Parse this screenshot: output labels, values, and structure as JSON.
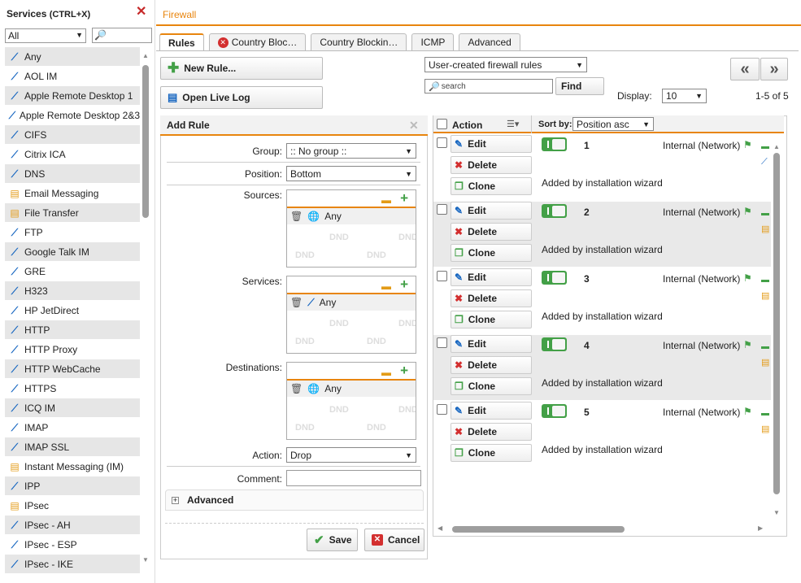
{
  "left_panel": {
    "title": "Services",
    "shortcut": "(CTRL+X)",
    "filter_value": "All",
    "services": [
      {
        "label": "Any",
        "icon": "cable-icon"
      },
      {
        "label": "AOL IM",
        "icon": "cable-icon"
      },
      {
        "label": "Apple Remote Desktop 1",
        "icon": "cable-icon"
      },
      {
        "label": "Apple Remote Desktop 2&3",
        "icon": "cable-icon"
      },
      {
        "label": "CIFS",
        "icon": "cable-icon"
      },
      {
        "label": "Citrix ICA",
        "icon": "cable-icon"
      },
      {
        "label": "DNS",
        "icon": "cable-icon"
      },
      {
        "label": "Email Messaging",
        "icon": "service-group-icon"
      },
      {
        "label": "File Transfer",
        "icon": "service-group-icon"
      },
      {
        "label": "FTP",
        "icon": "cable-icon"
      },
      {
        "label": "Google Talk IM",
        "icon": "cable-icon"
      },
      {
        "label": "GRE",
        "icon": "cable-icon"
      },
      {
        "label": "H323",
        "icon": "cable-icon"
      },
      {
        "label": "HP JetDirect",
        "icon": "cable-icon"
      },
      {
        "label": "HTTP",
        "icon": "cable-icon"
      },
      {
        "label": "HTTP Proxy",
        "icon": "cable-icon"
      },
      {
        "label": "HTTP WebCache",
        "icon": "cable-icon"
      },
      {
        "label": "HTTPS",
        "icon": "cable-icon"
      },
      {
        "label": "ICQ IM",
        "icon": "cable-icon"
      },
      {
        "label": "IMAP",
        "icon": "cable-icon"
      },
      {
        "label": "IMAP SSL",
        "icon": "cable-icon"
      },
      {
        "label": "Instant Messaging (IM)",
        "icon": "service-group-icon"
      },
      {
        "label": "IPP",
        "icon": "cable-icon"
      },
      {
        "label": "IPsec",
        "icon": "service-group-icon"
      },
      {
        "label": "IPsec - AH",
        "icon": "cable-icon"
      },
      {
        "label": "IPsec - ESP",
        "icon": "cable-icon"
      },
      {
        "label": "IPsec - IKE",
        "icon": "cable-icon"
      }
    ]
  },
  "header": {
    "title": "Firewall"
  },
  "tabs": [
    "Rules",
    "Country Bloc…",
    "Country Blockin…",
    "ICMP",
    "Advanced"
  ],
  "toolbar": {
    "new_rule": "New Rule...",
    "open_live_log": "Open Live Log",
    "filter_select": "User-created firewall rules",
    "search_placeholder": "search",
    "find": "Find",
    "display_label": "Display:",
    "display_value": "10",
    "range": "1-5 of 5",
    "prev": "«",
    "next": "»"
  },
  "add_rule": {
    "title": "Add Rule",
    "group_label": "Group:",
    "group_value": ":: No group ::",
    "position_label": "Position:",
    "position_value": "Bottom",
    "sources_label": "Sources:",
    "services_label": "Services:",
    "destinations_label": "Destinations:",
    "any": "Any",
    "dnd": "DND",
    "action_label": "Action:",
    "action_value": "Drop",
    "comment_label": "Comment:",
    "advanced_label": "Advanced",
    "save": "Save",
    "cancel": "Cancel"
  },
  "grid": {
    "action_header": "Action",
    "sort_label": "Sort by:",
    "sort_value": "Position asc",
    "edit": "Edit",
    "delete": "Delete",
    "clone": "Clone",
    "rules": [
      {
        "number": "1",
        "zone": "Internal (Network)",
        "comment": "Added by installation wizard",
        "enabled": true
      },
      {
        "number": "2",
        "zone": "Internal (Network)",
        "comment": "Added by installation wizard",
        "enabled": true
      },
      {
        "number": "3",
        "zone": "Internal (Network)",
        "comment": "Added by installation wizard",
        "enabled": true
      },
      {
        "number": "4",
        "zone": "Internal (Network)",
        "comment": "Added by installation wizard",
        "enabled": true
      },
      {
        "number": "5",
        "zone": "Internal (Network)",
        "comment": "Added by installation wizard",
        "enabled": true
      }
    ]
  },
  "colors": {
    "accent": "#e8850e",
    "enabled": "#43a047",
    "close": "#c62828"
  }
}
